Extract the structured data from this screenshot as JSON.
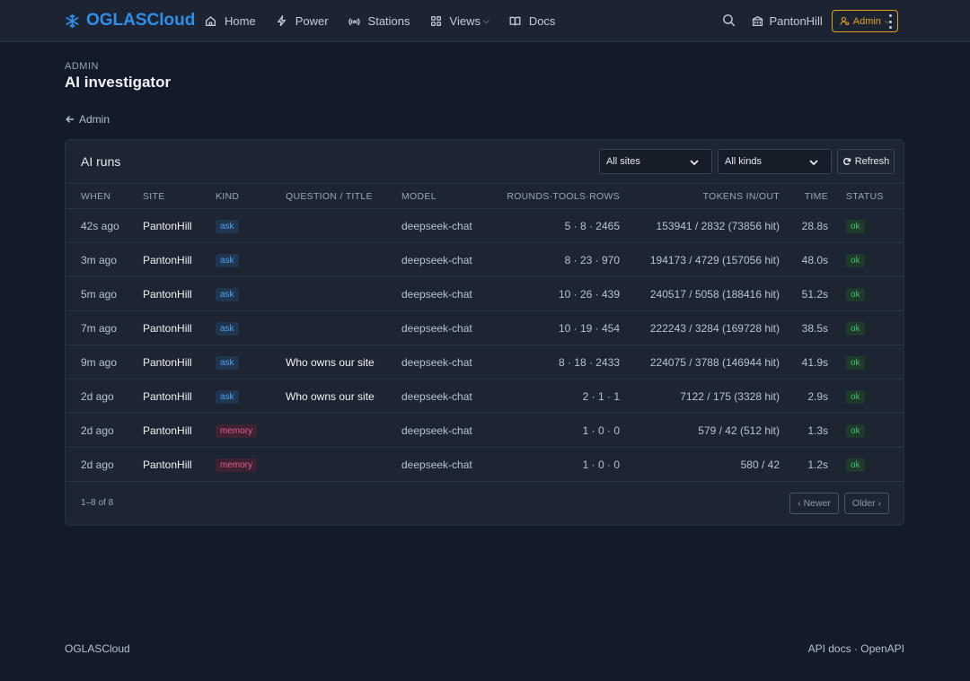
{
  "brand": {
    "name": "OGLASCloud",
    "color": "#2f8ee8"
  },
  "nav": {
    "items": [
      {
        "label": "Home",
        "icon": "home-icon"
      },
      {
        "label": "Power",
        "icon": "bolt-icon"
      },
      {
        "label": "Stations",
        "icon": "broadcast-icon"
      },
      {
        "label": "Views",
        "icon": "grid-icon",
        "dropdown": true
      },
      {
        "label": "Docs",
        "icon": "book-icon"
      }
    ],
    "site_label": "PantonHill",
    "admin_label": "Admin",
    "accent": "#e0a020"
  },
  "page": {
    "eyebrow": "ADMIN",
    "title": "AI investigator",
    "back_label": "Admin"
  },
  "card": {
    "title": "AI runs",
    "filter_site": "All sites",
    "filter_kind": "All kinds",
    "refresh_label": "Refresh",
    "columns": [
      "WHEN",
      "SITE",
      "KIND",
      "QUESTION / TITLE",
      "MODEL",
      "ROUNDS·TOOLS·ROWS",
      "TOKENS IN/OUT",
      "TIME",
      "STATUS"
    ],
    "rows": [
      {
        "when": "42s ago",
        "site": "PantonHill",
        "kind": "ask",
        "question": "",
        "model": "deepseek-chat",
        "rtr": "5 · 8 · 2465",
        "tokens": "153941 / 2832 (73856 hit)",
        "time": "28.8s",
        "status": "ok"
      },
      {
        "when": "3m ago",
        "site": "PantonHill",
        "kind": "ask",
        "question": "",
        "model": "deepseek-chat",
        "rtr": "8 · 23 · 970",
        "tokens": "194173 / 4729 (157056 hit)",
        "time": "48.0s",
        "status": "ok"
      },
      {
        "when": "5m ago",
        "site": "PantonHill",
        "kind": "ask",
        "question": "",
        "model": "deepseek-chat",
        "rtr": "10 · 26 · 439",
        "tokens": "240517 / 5058 (188416 hit)",
        "time": "51.2s",
        "status": "ok"
      },
      {
        "when": "7m ago",
        "site": "PantonHill",
        "kind": "ask",
        "question": "",
        "model": "deepseek-chat",
        "rtr": "10 · 19 · 454",
        "tokens": "222243 / 3284 (169728 hit)",
        "time": "38.5s",
        "status": "ok"
      },
      {
        "when": "9m ago",
        "site": "PantonHill",
        "kind": "ask",
        "question": "Who owns our site",
        "model": "deepseek-chat",
        "rtr": "8 · 18 · 2433",
        "tokens": "224075 / 3788 (146944 hit)",
        "time": "41.9s",
        "status": "ok"
      },
      {
        "when": "2d ago",
        "site": "PantonHill",
        "kind": "ask",
        "question": "Who owns our site",
        "model": "deepseek-chat",
        "rtr": "2 · 1 · 1",
        "tokens": "7122 / 175 (3328 hit)",
        "time": "2.9s",
        "status": "ok"
      },
      {
        "when": "2d ago",
        "site": "PantonHill",
        "kind": "memory",
        "question": "",
        "model": "deepseek-chat",
        "rtr": "1 · 0 · 0",
        "tokens": "579 / 42 (512 hit)",
        "time": "1.3s",
        "status": "ok"
      },
      {
        "when": "2d ago",
        "site": "PantonHill",
        "kind": "memory",
        "question": "",
        "model": "deepseek-chat",
        "rtr": "1 · 0 · 0",
        "tokens": "580 / 42",
        "time": "1.2s",
        "status": "ok"
      }
    ],
    "count_text": "1–8 of 8",
    "newer_label": "Newer",
    "older_label": "Older"
  },
  "footer": {
    "left": "OGLASCloud",
    "api_docs": "API docs",
    "sep": "·",
    "openapi": "OpenAPI"
  }
}
